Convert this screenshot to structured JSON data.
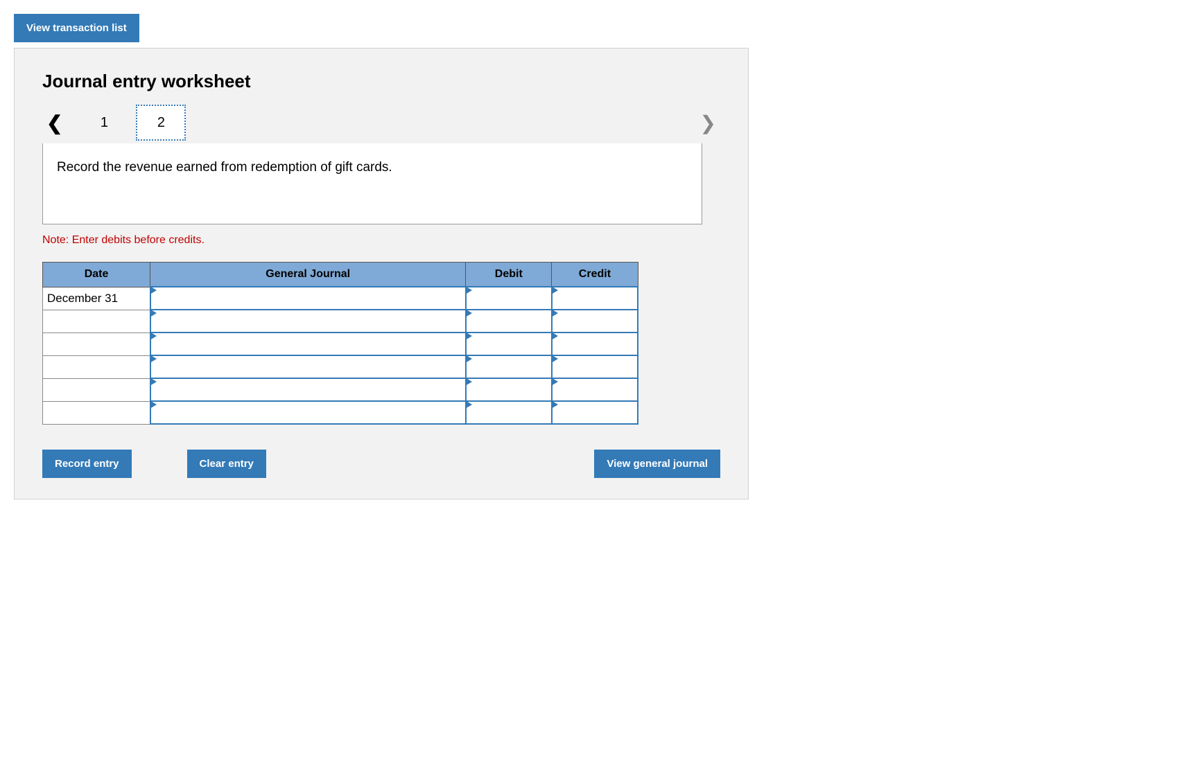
{
  "top": {
    "view_transaction_list": "View transaction list"
  },
  "panel": {
    "title": "Journal entry worksheet",
    "tabs": {
      "page1": "1",
      "page2": "2"
    },
    "instruction": "Record the revenue earned from redemption of gift cards.",
    "note": "Note: Enter debits before credits."
  },
  "table": {
    "headers": {
      "date": "Date",
      "gj": "General Journal",
      "debit": "Debit",
      "credit": "Credit"
    },
    "rows": [
      {
        "date": "December 31",
        "gj": "",
        "debit": "",
        "credit": ""
      },
      {
        "date": "",
        "gj": "",
        "debit": "",
        "credit": ""
      },
      {
        "date": "",
        "gj": "",
        "debit": "",
        "credit": ""
      },
      {
        "date": "",
        "gj": "",
        "debit": "",
        "credit": ""
      },
      {
        "date": "",
        "gj": "",
        "debit": "",
        "credit": ""
      },
      {
        "date": "",
        "gj": "",
        "debit": "",
        "credit": ""
      }
    ]
  },
  "actions": {
    "record": "Record entry",
    "clear": "Clear entry",
    "view_gj": "View general journal"
  }
}
